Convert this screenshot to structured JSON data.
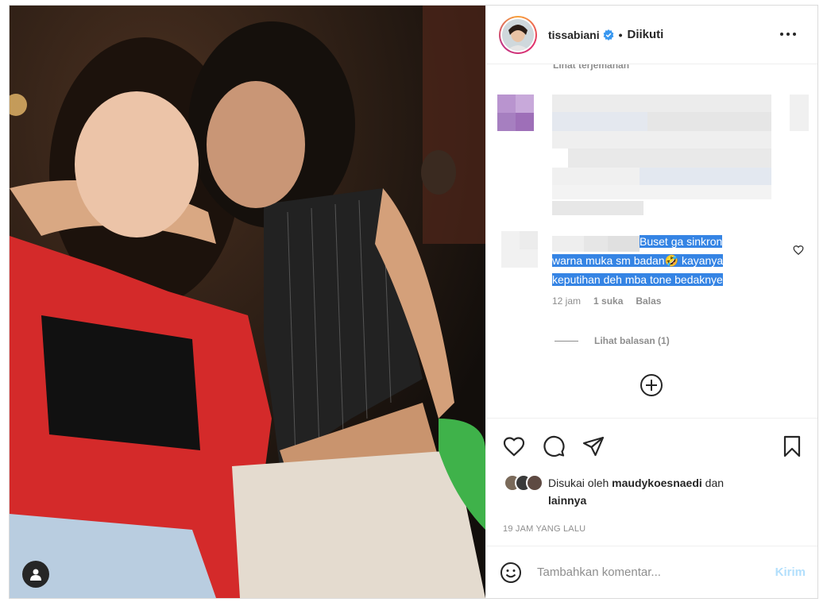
{
  "post": {
    "username": "tissabiani",
    "separator": "•",
    "follow_status": "Diikuti"
  },
  "comments": {
    "see_translation": "Lihat terjemahan",
    "comment": {
      "text_line1": "Buset ga sinkron",
      "text_line2_a": "warna muka sm badan",
      "text_line2_b": " kayanya",
      "text_line3": "keputihan deh mba tone bedaknye",
      "emoji": "🤣",
      "time": "12 jam",
      "likes": "1 suka",
      "reply": "Balas"
    },
    "view_replies": "Lihat balasan (1)"
  },
  "likes": {
    "prefix": "Disukai oleh ",
    "user": "maudykoesnaedi",
    "middle": " dan",
    "others": "lainnya"
  },
  "timestamp": "19 JAM YANG LALU",
  "add_comment": {
    "placeholder": "Tambahkan komentar...",
    "post_label": "Kirim"
  },
  "colors": {
    "verified": "#3897f0",
    "highlight": "#3584e4",
    "post_disabled": "#b2dffc"
  }
}
